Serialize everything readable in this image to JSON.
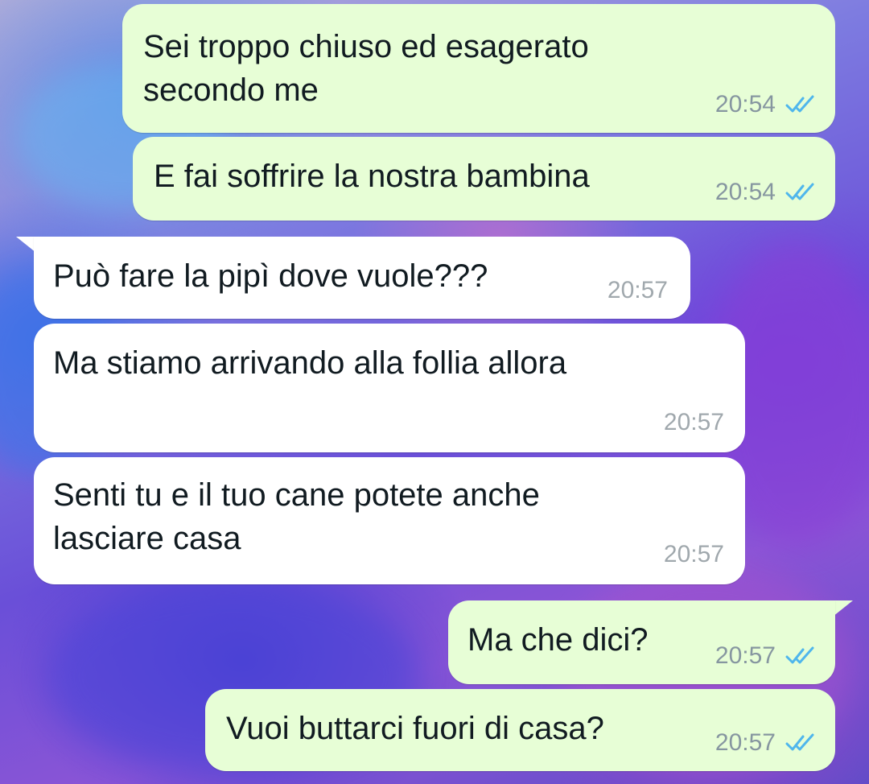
{
  "chat": {
    "messages": [
      {
        "direction": "out",
        "text": "Sei troppo chiuso ed esagerato\nsecondo me",
        "time": "20:54",
        "status_icon": "double-check-read-icon",
        "status_color": "#4fb6ec"
      },
      {
        "direction": "out",
        "text": "E fai soffrire la nostra bambina",
        "time": "20:54",
        "status_icon": "double-check-read-icon",
        "status_color": "#4fb6ec"
      },
      {
        "direction": "in",
        "text": "Può fare la pipì dove vuole???",
        "time": "20:57"
      },
      {
        "direction": "in",
        "text": "Ma stiamo arrivando alla follia allora",
        "time": "20:57"
      },
      {
        "direction": "in",
        "text": "Senti tu e il tuo cane potete anche\nlasciare casa",
        "time": "20:57"
      },
      {
        "direction": "out",
        "text": "Ma che dici?",
        "time": "20:57",
        "status_icon": "double-check-read-icon",
        "status_color": "#4fb6ec"
      },
      {
        "direction": "out",
        "text": "Vuoi buttarci fuori di casa?",
        "time": "20:57",
        "status_icon": "double-check-read-icon",
        "status_color": "#4fb6ec"
      }
    ]
  },
  "colors": {
    "outgoing_bubble": "#e7fed6",
    "incoming_bubble": "#ffffff",
    "read_ticks": "#4fb6ec",
    "timestamp": "#8696a0"
  }
}
